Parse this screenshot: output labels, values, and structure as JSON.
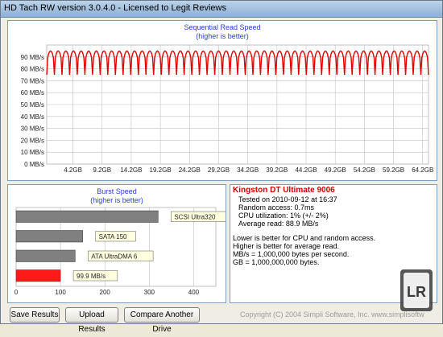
{
  "window": {
    "title": "HD Tach RW version 3.0.4.0 - Licensed to Legit Reviews"
  },
  "chart_data": [
    {
      "type": "line",
      "title": "Sequential Read Speed",
      "subtitle": "(higher is better)",
      "y_ticks": [
        "90 MB/s",
        "80 MB/s",
        "70 MB/s",
        "60 MB/s",
        "50 MB/s",
        "40 MB/s",
        "30 MB/s",
        "20 MB/s",
        "10 MB/s",
        "0 MB/s"
      ],
      "x_ticks": [
        "4.2GB",
        "9.2GB",
        "14.2GB",
        "19.2GB",
        "24.2GB",
        "29.2GB",
        "34.2GB",
        "39.2GB",
        "44.2GB",
        "49.2GB",
        "54.2GB",
        "59.2GB",
        "64.2GB"
      ],
      "ylim": [
        0,
        100
      ],
      "series": [
        {
          "color": "#e00000",
          "pattern": {
            "peak": 95,
            "dip": 75,
            "cycles": 50
          }
        }
      ]
    },
    {
      "type": "bar",
      "title": "Burst Speed",
      "subtitle": "(higher is better)",
      "categories": [
        "SCSI Ultra320",
        "SATA 150",
        "ATA UltraDMA 6",
        "99.9 MB/s"
      ],
      "values": [
        320,
        150,
        133,
        99.9
      ],
      "colors": [
        "#808080",
        "#808080",
        "#808080",
        "#ff1a1a"
      ],
      "x_ticks": [
        "0",
        "100",
        "200",
        "300",
        "400"
      ],
      "xlim": [
        0,
        450
      ]
    }
  ],
  "info": {
    "title": "Kingston DT Ultimate 9006",
    "tested": "Tested on 2010-09-12 at 16:37",
    "random_access": "Random access: 0.7ms",
    "cpu": "CPU utilization: 1% (+/- 2%)",
    "avg_read": "Average read: 88.9 MB/s",
    "note1": "Lower is better for CPU and random access.",
    "note2": "Higher is better for average read.",
    "note3": "MB/s = 1,000,000 bytes per second.",
    "note4": "GB = 1,000,000,000 bytes."
  },
  "buttons": {
    "save": "Save Results",
    "upload": "Upload Results",
    "compare": "Compare Another Drive"
  },
  "footer": {
    "copyright": "Copyright (C) 2004 Simpli Software, Inc. www.simplisoftw"
  },
  "logo": {
    "text": "LR"
  }
}
